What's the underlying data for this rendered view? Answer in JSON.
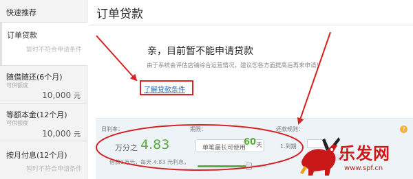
{
  "sidebar": {
    "items": [
      {
        "title": "快速推荐"
      },
      {
        "title": "订单贷款",
        "note": "暂时不符合申请条件"
      },
      {
        "title": "随借随还(6个月)",
        "sub": "可供额度",
        "amount": "10,000",
        "unit": "元"
      },
      {
        "title": "等额本金(12个月)",
        "sub": "可供额度",
        "amount": "10,000",
        "unit": "元"
      },
      {
        "title": "按月付息(12个月)",
        "note": "暂时不符合申请条件"
      }
    ]
  },
  "main": {
    "title": "订单贷款",
    "message_heading": "亲，目前暂不能申请贷款",
    "message_body": "由于系统会评估店铺综合运营情况，建议您各方面提高后再来申请！",
    "link_label": "了解贷款条件"
  },
  "calculator": {
    "rate_label": "日利率：",
    "rate_prefix": "万分之",
    "rate_value": "4.83",
    "rate_note": "借款1万元，每天 4.83 元利息。",
    "term_label": "期限：",
    "term_text": "单笔最长可使用",
    "term_days": "60",
    "term_unit": "天",
    "repay_label": "还款规则：",
    "step_mark": "1.到期",
    "slider_fraction": 0.75
  },
  "watermark": {
    "text": "乐发网",
    "url": "www.spf.cn"
  },
  "colors": {
    "accent_green": "#5aaa3c",
    "annotation_red": "#d22222",
    "link_blue": "#2a6db5"
  }
}
